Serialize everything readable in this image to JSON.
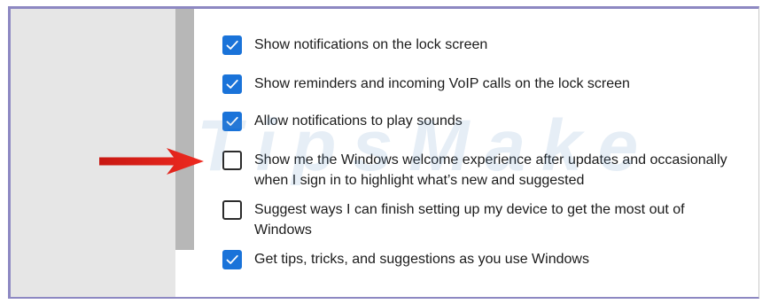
{
  "settings": {
    "items": [
      {
        "label": "Show notifications on the lock screen",
        "checked": true
      },
      {
        "label": "Show reminders and incoming VoIP calls on the lock screen",
        "checked": true
      },
      {
        "label": "Allow notifications to play sounds",
        "checked": true
      },
      {
        "label": "Show me the Windows welcome experience after updates and occasionally when I sign in to highlight what’s new and suggested",
        "checked": false
      },
      {
        "label": "Suggest ways I can finish setting up my device to get the most out of Windows",
        "checked": false
      },
      {
        "label": "Get tips, tricks, and suggestions as you use Windows",
        "checked": true
      }
    ]
  },
  "watermark": {
    "text": "TipsMake"
  },
  "colors": {
    "accent": "#1a73d9",
    "arrow": "#e0221b",
    "frame": "#8d88c2"
  },
  "icons": {
    "check": "check-icon",
    "arrow": "red-arrow-icon"
  }
}
